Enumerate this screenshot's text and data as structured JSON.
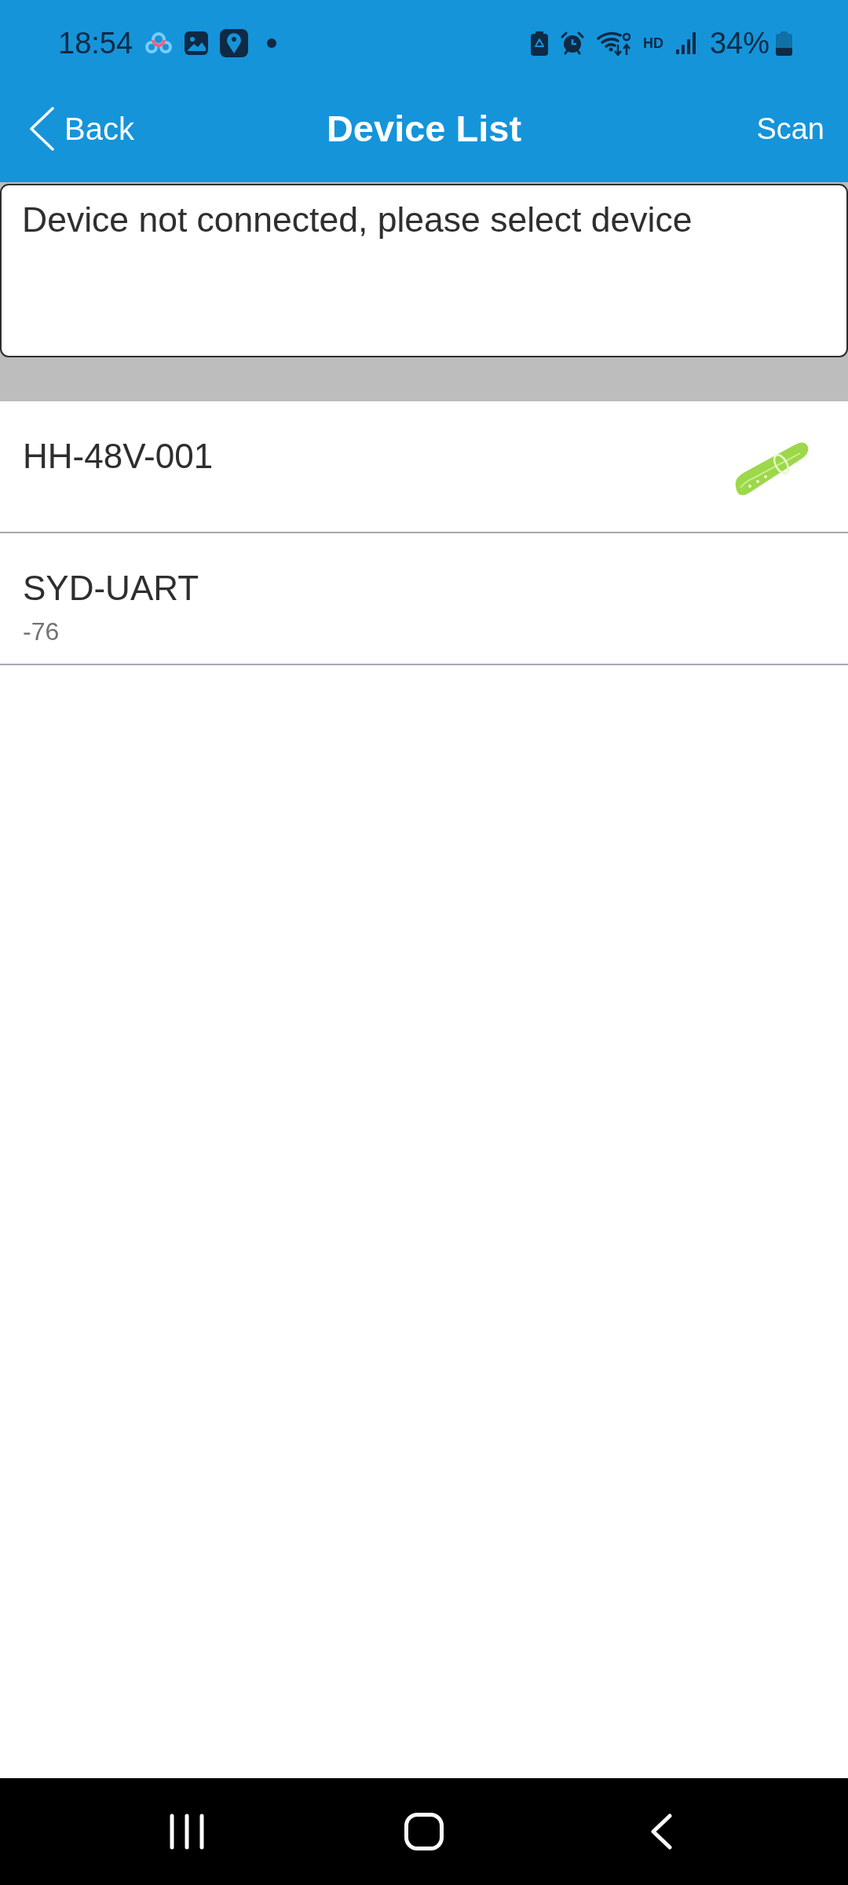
{
  "status_bar": {
    "time": "18:54",
    "network_label": "HD",
    "battery": "34%"
  },
  "title_bar": {
    "back": "Back",
    "title": "Device List",
    "action": "Scan"
  },
  "status_message": "Device not connected, please select device",
  "devices": [
    {
      "name": "HH-48V-001",
      "kind": "collar",
      "selected": false
    },
    {
      "name": "SYD-UART",
      "rssi": "-76",
      "kind": "plain",
      "selected": false
    }
  ]
}
